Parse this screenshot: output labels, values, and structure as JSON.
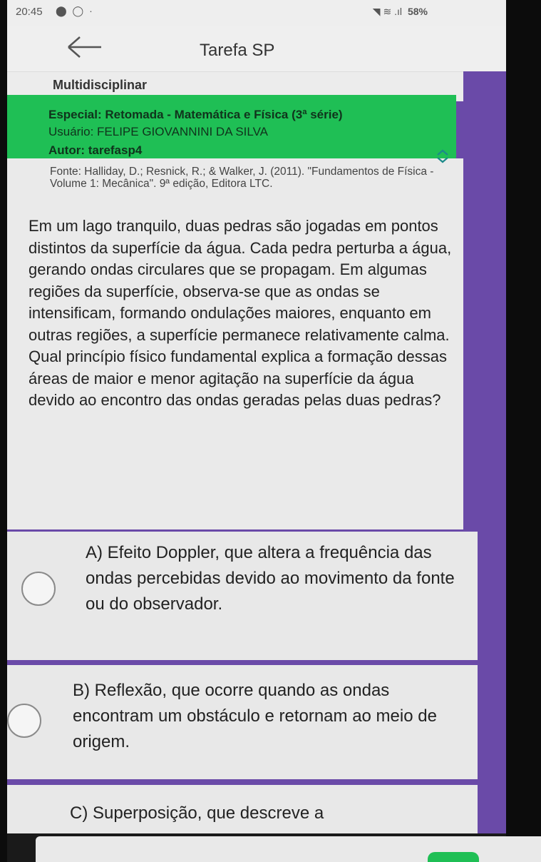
{
  "status": {
    "time": "20:45",
    "left_icons": "⬤ ◯ ·",
    "signal": "◥ ≋ .ıl",
    "battery": "58%"
  },
  "appbar": {
    "title": "Tarefa SP"
  },
  "category": "Multidisciplinar",
  "header": {
    "special": "Especial: Retomada - Matemática e Física (3ª série)",
    "user": "Usuário: FELIPE GIOVANNINI DA SILVA",
    "author": "Autor: tarefasp4"
  },
  "question": {
    "source": "Fonte: Halliday, D.; Resnick, R.; & Walker, J. (2011). \"Fundamentos de Física - Volume 1: Mecânica\". 9ª edição, Editora LTC.",
    "text": "Em um lago tranquilo, duas pedras são jogadas em pontos distintos da superfície da água. Cada pedra perturba a água, gerando ondas circulares que se propagam. Em algumas regiões da superfície, observa-se que as ondas se intensificam, formando ondulações maiores, enquanto em outras regiões, a superfície permanece relativamente calma. Qual princípio físico fundamental explica a formação dessas áreas de maior e menor agitação na superfície da água devido ao encontro das ondas geradas pelas duas pedras?"
  },
  "options": [
    {
      "text": "A) Efeito Doppler, que altera a frequência das ondas percebidas devido ao movimento da fonte ou do observador."
    },
    {
      "text": "B) Reflexão, que ocorre quando as ondas encontram um obstáculo e retornam ao meio de origem."
    },
    {
      "text": "C) Superposição, que descreve a"
    }
  ],
  "colors": {
    "accent_green": "#1fbf55",
    "frame_purple": "#6a4aa8"
  }
}
